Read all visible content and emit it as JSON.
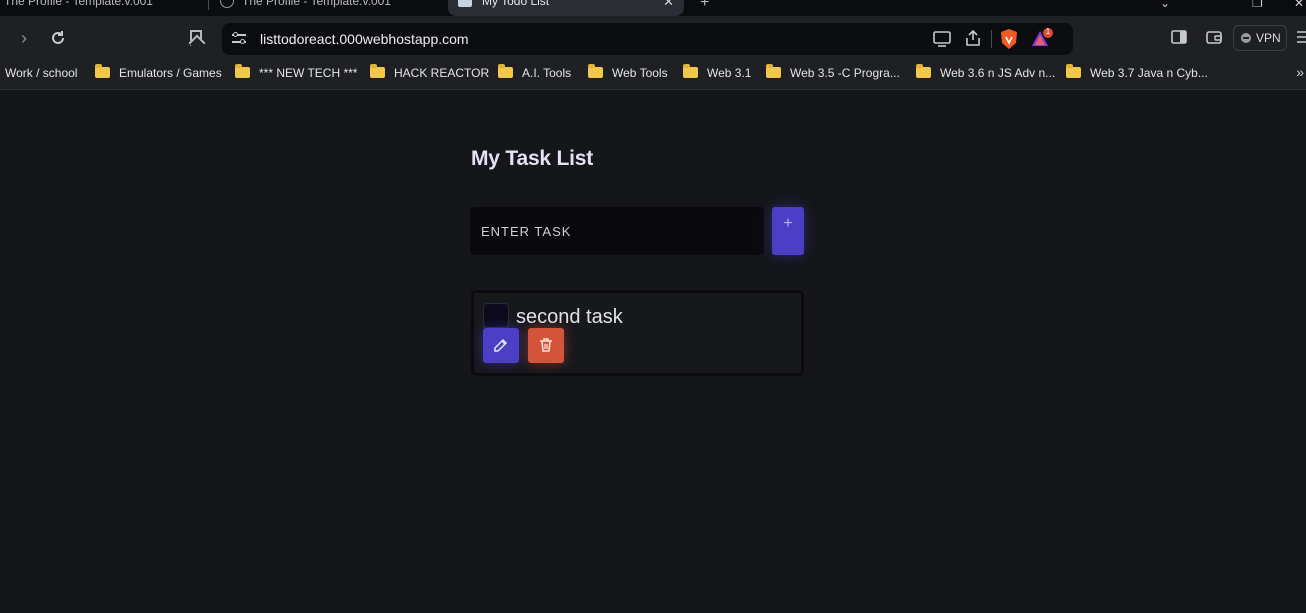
{
  "browser": {
    "tabs": [
      {
        "label": "The Profile - Template.v.001"
      },
      {
        "label": "The Profile - Template.v.001"
      },
      {
        "label": "My Todo List",
        "active": true
      }
    ],
    "url": "listtodoreact.000webhostapp.com",
    "vpn_label": "VPN",
    "notification_count": "1",
    "bookmarks": [
      {
        "label": "Work / school",
        "folder": false
      },
      {
        "label": "Emulators / Games",
        "folder": true
      },
      {
        "label": "*** NEW TECH ***",
        "folder": true
      },
      {
        "label": "HACK REACTOR",
        "folder": true
      },
      {
        "label": "A.I. Tools",
        "folder": true
      },
      {
        "label": "Web Tools",
        "folder": true
      },
      {
        "label": "Web 3.1",
        "folder": true
      },
      {
        "label": "Web 3.5  -C Progra...",
        "folder": true
      },
      {
        "label": "Web 3.6 n JS Adv n...",
        "folder": true
      },
      {
        "label": "Web 3.7 Java n Cyb...",
        "folder": true
      }
    ],
    "bookmarks_overflow": "»"
  },
  "app": {
    "title": "My Task List",
    "input_placeholder": "ENTER TASK",
    "add_label": "+",
    "tasks": [
      {
        "text": "second task",
        "done": false
      }
    ]
  },
  "colors": {
    "accent": "#4c3fc6",
    "danger": "#d3533b",
    "page_bg": "#15161a"
  }
}
